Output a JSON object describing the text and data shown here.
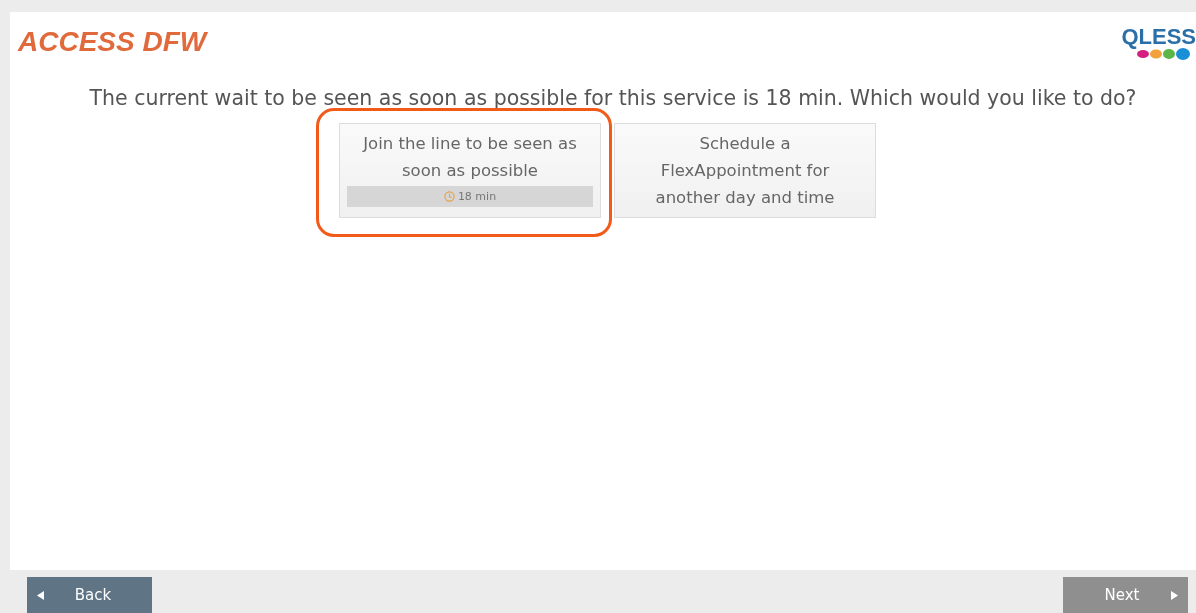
{
  "header": {
    "title": "ACCESS DFW",
    "logo": "QLESS"
  },
  "prompt": "The current wait to be seen as soon as possible for this service is 18 min. Which would you like to do?",
  "options": [
    {
      "kind": "queue",
      "label": "Join the line to be seen as soon as possible",
      "wait": "18 min",
      "highlighted": true
    },
    {
      "kind": "appointment",
      "label": "Schedule a FlexAppointment for another day and time",
      "highlighted": false
    }
  ],
  "footer": {
    "back": {
      "label": "Back",
      "disabled": false
    },
    "next": {
      "label": "Next",
      "disabled": true
    }
  }
}
